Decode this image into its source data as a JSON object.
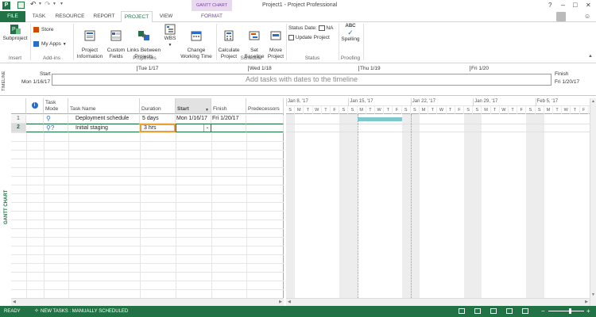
{
  "titlebar": {
    "title": "Project1 - Project Professional",
    "context_tab_group": "GANTT CHART TOOLS",
    "help": "?",
    "minimize": "–",
    "restore": "□",
    "close": "✕"
  },
  "tabs": {
    "file": "FILE",
    "task": "TASK",
    "resource": "RESOURCE",
    "report": "REPORT",
    "project": "PROJECT",
    "view": "VIEW",
    "format": "FORMAT"
  },
  "ribbon": {
    "insert": {
      "subproject": "Subproject",
      "group": "Insert"
    },
    "addins": {
      "store": "Store",
      "my_apps": "My Apps",
      "group": "Add-ins"
    },
    "properties": {
      "project_information": "Project\nInformation",
      "custom_fields": "Custom\nFields",
      "links_between": "Links Between\nProjects",
      "wbs": "WBS",
      "change_working_time": "Change\nWorking Time",
      "group": "Properties"
    },
    "schedule": {
      "calculate": "Calculate\nProject",
      "set_baseline": "Set\nBaseline",
      "move": "Move\nProject",
      "group": "Schedule"
    },
    "status": {
      "status_date_label": "Status Date:",
      "status_date_value": "NA",
      "update_project": "Update Project",
      "group": "Status"
    },
    "proofing": {
      "spelling": "Spelling",
      "abc": "ABC",
      "group": "Proofing"
    }
  },
  "timeline": {
    "side_label": "TIMELINE",
    "start_label": "Start",
    "start_date": "Mon 1/16/17",
    "finish_label": "Finish",
    "finish_date": "Fri 1/20/17",
    "ticks": [
      "Tue 1/17",
      "Wed 1/18",
      "Thu 1/19",
      "Fri 1/20"
    ],
    "placeholder": "Add tasks with dates to the timeline"
  },
  "grid": {
    "side_label": "GANTT CHART",
    "columns": {
      "info": "i",
      "mode": "Task\nMode",
      "name": "Task Name",
      "duration": "Duration",
      "start": "Start",
      "finish": "Finish",
      "predecessors": "Predecessors"
    },
    "rows": [
      {
        "id": "1",
        "name": "Deployment schedule",
        "duration": "5 days",
        "start": "Mon 1/16/17",
        "finish": "Fri 1/20/17",
        "predecessors": ""
      },
      {
        "id": "2",
        "name": "Initial staging",
        "duration": "3 hrs",
        "start": "",
        "finish": "",
        "predecessors": ""
      }
    ]
  },
  "gantt": {
    "weeks": [
      "Jan 8, '17",
      "Jan 15, '17",
      "Jan 22, '17",
      "Jan 29, '17",
      "Feb 5, '17"
    ],
    "days": [
      "S",
      "M",
      "T",
      "W",
      "T",
      "F",
      "S",
      "S",
      "M",
      "T",
      "W",
      "T",
      "F",
      "S",
      "S",
      "M",
      "T",
      "W",
      "T",
      "F",
      "S",
      "S",
      "M",
      "T",
      "W",
      "T",
      "F",
      "S",
      "S",
      "M",
      "T",
      "W",
      "T",
      "F"
    ],
    "bar_color": "#7bc8cf"
  },
  "statusbar": {
    "ready": "READY",
    "new_tasks": "NEW TASKS : MANUALLY SCHEDULED"
  },
  "colors": {
    "accent": "#217346",
    "context_tab": "#7b3fa0",
    "selected_cell": "#e8a234"
  }
}
